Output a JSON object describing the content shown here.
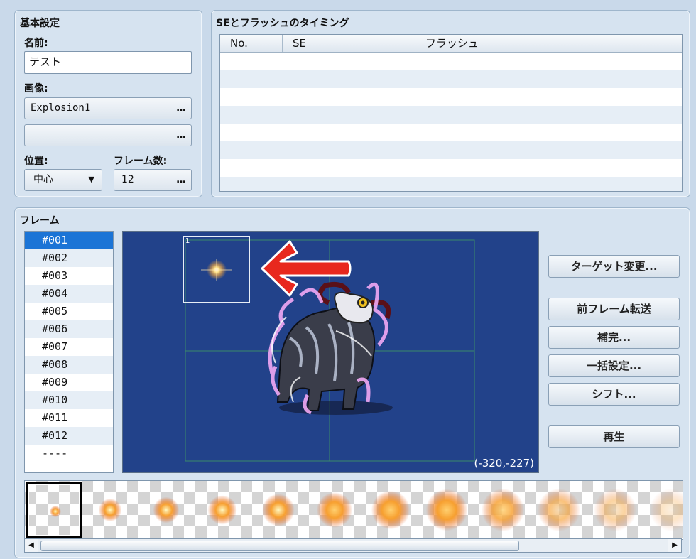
{
  "basic": {
    "title": "基本設定",
    "name_label": "名前:",
    "name_value": "テスト",
    "image_label": "画像:",
    "image1": "Explosion1",
    "image2": "",
    "dots": "...",
    "position_label": "位置:",
    "position_value": "中心",
    "frames_label": "フレーム数:",
    "frames_value": "12"
  },
  "se": {
    "title": "SEとフラッシュのタイミング",
    "columns": [
      "No.",
      "SE",
      "フラッシュ"
    ]
  },
  "frame": {
    "title": "フレーム",
    "items": [
      "#001",
      "#002",
      "#003",
      "#004",
      "#005",
      "#006",
      "#007",
      "#008",
      "#009",
      "#010",
      "#011",
      "#012",
      "----"
    ],
    "selected_index": 0,
    "cell_label": "1",
    "coords": "(-320,-227)"
  },
  "buttons": {
    "target": "ターゲット変更...",
    "copy_prev": "前フレーム転送",
    "tween": "補完...",
    "batch": "一括設定...",
    "shift": "シフト...",
    "play": "再生"
  },
  "colors": {
    "accent": "#1b74d6",
    "canvas": "#22428a",
    "arrow": "#e8281e"
  },
  "icons": {
    "dropdown": "triangle-down-icon",
    "scroll_left": "scroll-left-icon",
    "scroll_right": "scroll-right-icon"
  }
}
